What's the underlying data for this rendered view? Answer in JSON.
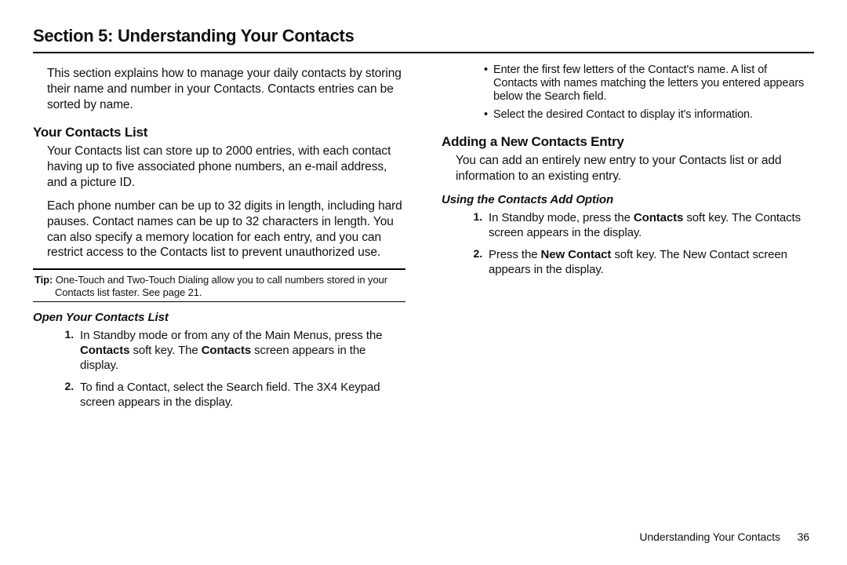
{
  "title": "Section 5: Understanding Your Contacts",
  "intro": "This section explains how to manage your daily contacts by storing their name and number in your Contacts. Contacts entries can be sorted by name.",
  "left": {
    "h_your_list": "Your Contacts List",
    "p_list_1": "Your Contacts list can store up to 2000 entries, with each contact having up to five associated phone numbers, an e-mail address, and a picture ID.",
    "p_list_2": "Each phone number can be up to 32 digits in length, including hard pauses. Contact names can be up to 32 characters in length. You can also specify a memory location for each entry, and you can restrict access to the Contacts list to prevent unauthorized use.",
    "tip_label": "Tip:",
    "tip_text": "One-Touch and Two-Touch Dialing allow you to call numbers stored in your Contacts list faster. See page 21.",
    "h_open": "Open Your Contacts List",
    "open_steps": {
      "s1_a": "In Standby mode or from any of the Main Menus, press the ",
      "s1_b1": "Contacts",
      "s1_c": " soft key. The ",
      "s1_b2": "Contacts",
      "s1_d": " screen appears in the display.",
      "s2": "To find a Contact, select the Search field. The 3X4 Keypad screen appears in the display."
    }
  },
  "right": {
    "bullets": {
      "b1": "Enter the first few letters of the Contact's name. A list of Contacts with names matching the letters you entered appears below the Search field.",
      "b2": "Select the desired Contact to display it's information."
    },
    "h_adding": "Adding a New Contacts Entry",
    "p_adding": "You can add an entirely new entry to your Contacts list or add information to an existing entry.",
    "h_using": "Using the Contacts Add Option",
    "use_steps": {
      "s1_a": "In Standby mode, press the ",
      "s1_b": "Contacts",
      "s1_c": " soft key. The Contacts screen appears in the display.",
      "s2_a": "Press the ",
      "s2_b": "New Contact",
      "s2_c": " soft key. The New Contact screen appears in the display."
    }
  },
  "footer": {
    "section": "Understanding Your Contacts",
    "page": "36"
  }
}
